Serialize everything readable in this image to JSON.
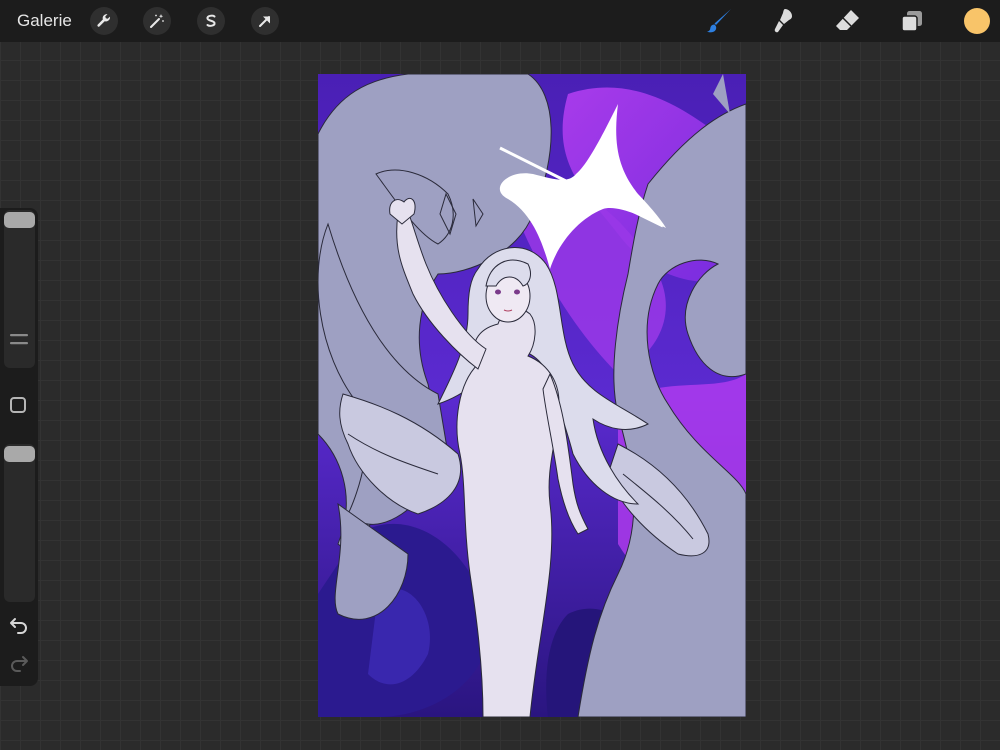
{
  "topbar": {
    "gallery_label": "Galerie",
    "left_tools": [
      "wrench-icon",
      "magic-wand-icon",
      "selection-icon",
      "transform-arrow-icon"
    ],
    "right_tools": [
      "brush-icon",
      "smudge-icon",
      "eraser-icon",
      "layers-icon"
    ],
    "active_tool": "brush-icon",
    "active_color": "#f8c469"
  },
  "sidebar": {
    "controls": [
      "brush-size-slider",
      "modify-square-button",
      "opacity-slider",
      "undo-icon",
      "redo-icon"
    ]
  },
  "canvas": {
    "artwork": "illustration-of-angel-with-dragon-silhouettes"
  }
}
